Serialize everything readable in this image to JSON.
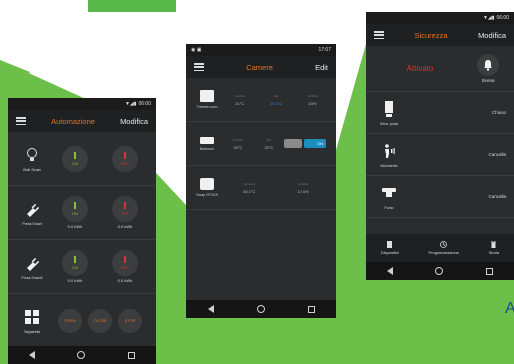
{
  "caption": "A",
  "colors": {
    "green": "#58b84a",
    "accent": "#e77226",
    "on": "#86c13d",
    "off": "#d9312b",
    "blue": "#2f7fd1"
  },
  "phone1": {
    "status_time": "06:00",
    "title": "Automazione",
    "action": "Modifica",
    "rows": [
      {
        "device": "Bulb Smart",
        "icon": "bulb-icon",
        "on_label": "ON",
        "off_label": "OFF",
        "on_value": "",
        "off_value": ""
      },
      {
        "device": "Presa Smart",
        "icon": "plug-icon",
        "on_label": "ON",
        "off_label": "OFF",
        "on_value": "0.0 kWh",
        "off_value": "0.0 kWh"
      },
      {
        "device": "Presa Smart2",
        "icon": "plug-icon",
        "on_label": "ON",
        "off_label": "OFF",
        "on_value": "0.0 kWh",
        "off_value": "0.0 kWh"
      },
      {
        "device": "Tapparella",
        "icon": "window-icon",
        "btn_open": "OPEN",
        "btn_close": "CLOSE",
        "btn_stop": "STOP"
      }
    ]
  },
  "phone2": {
    "status_time": "17:07",
    "title": "Camere",
    "action": "Edit",
    "rows": [
      {
        "device": "Frames room",
        "k1": "Comfort",
        "v1": "21°C",
        "k2": "Set",
        "v2": "20.5°C",
        "k3": "Umidità",
        "v3": "43%"
      },
      {
        "device": "Bedroom",
        "k1": "Comfort",
        "v1": "20°C",
        "k2": "Set",
        "v2": "20°C",
        "toggle": "ON"
      },
      {
        "device": "Swap HTVG9",
        "k1": "Consumi",
        "v1": "40.1°C",
        "k3": "Umidità",
        "v3": "17.6%"
      }
    ]
  },
  "phone3": {
    "status_time": "06:00",
    "title": "Sicurezza",
    "action": "Modifica",
    "state": "Attivato",
    "siren": "Sirena",
    "rows": [
      {
        "device": "Sens. porta",
        "icon": "door-sensor-icon",
        "value": "Chiuso"
      },
      {
        "device": "Movimento",
        "icon": "motion-icon",
        "value": "Cancella"
      },
      {
        "device": "Fumo",
        "icon": "smoke-detector-icon",
        "value": "Cancella"
      }
    ],
    "tabs": [
      "Dispositivi",
      "Programmazione",
      "Storia"
    ]
  }
}
